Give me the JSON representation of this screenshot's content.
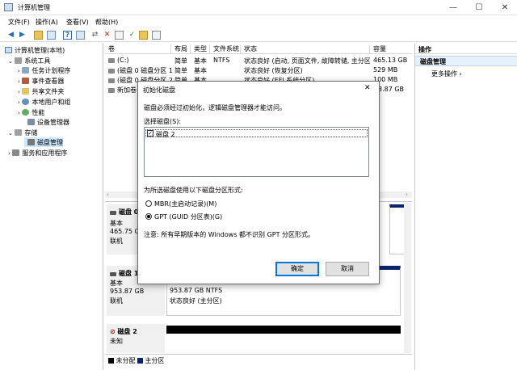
{
  "window": {
    "title": "计算机管理",
    "min": "—",
    "max": "☐",
    "close": "✕"
  },
  "menu": [
    "文件(F)",
    "操作(A)",
    "查看(V)",
    "帮助(H)"
  ],
  "tree": {
    "root": "计算机管理(本地)",
    "system_tools": "系统工具",
    "task_scheduler": "任务计划程序",
    "event_viewer": "事件查看器",
    "shared_folders": "共享文件夹",
    "local_users": "本地用户和组",
    "performance": "性能",
    "device_manager": "设备管理器",
    "storage": "存储",
    "disk_management": "磁盘管理",
    "services": "服务和应用程序"
  },
  "volumes": {
    "headers": [
      "卷",
      "布局",
      "类型",
      "文件系统",
      "状态",
      "容量"
    ],
    "rows": [
      [
        "(C:)",
        "简单",
        "基本",
        "NTFS",
        "状态良好 (启动, 页面文件, 故障转储, 主分区)",
        "465.13 GB"
      ],
      [
        "(磁盘 0 磁盘分区 1)",
        "简单",
        "基本",
        "",
        "状态良好 (恢复分区)",
        "529 MB"
      ],
      [
        "(磁盘 0 磁盘分区 2)",
        "简单",
        "基本",
        "",
        "状态良好 (EFI 系统分区)",
        "100 MB"
      ],
      [
        "新加卷",
        "",
        "",
        "",
        "",
        "3.87 GB"
      ]
    ]
  },
  "disks": [
    {
      "name": "磁盘 0",
      "type": "基本",
      "size": "465.75 GB",
      "status": "联机"
    },
    {
      "name": "磁盘 1",
      "type": "基本",
      "size": "953.87 GB",
      "status": "联机",
      "part_size": "953.87 GB NTFS",
      "part_status": "状态良好 (主分区)"
    },
    {
      "name": "磁盘 2",
      "type": "未知"
    }
  ],
  "legend": {
    "unallocated": "未分配",
    "primary": "主分区"
  },
  "actions": {
    "header": "操作",
    "section": "磁盘管理",
    "more": "更多操作"
  },
  "dialog": {
    "title": "初始化磁盘",
    "intro": "磁盘必须经过初始化，逻辑磁盘管理器才能访问。",
    "select_label": "选择磁盘(S):",
    "disk_item": "磁盘 2",
    "style_label": "为所选磁盘使用以下磁盘分区形式:",
    "mbr": "MBR(主启动记录)(M)",
    "gpt": "GPT (GUID 分区表)(G)",
    "note": "注意: 所有早期版本的 Windows 都不识别 GPT 分区形式。",
    "ok": "确定",
    "cancel": "取消",
    "close": "✕"
  },
  "colors": {
    "accent": "#0078d7",
    "unallocated": "#000000",
    "primary": "#0a246a",
    "selection": "#cce8ff"
  }
}
